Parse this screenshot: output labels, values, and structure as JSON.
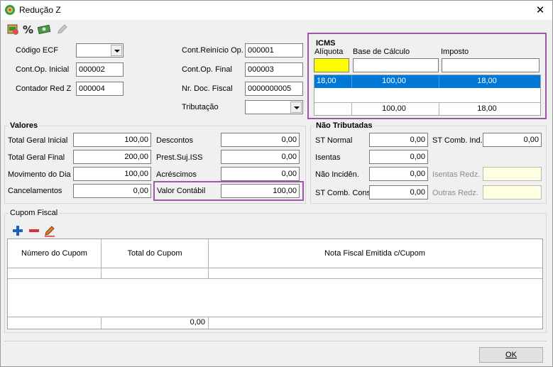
{
  "window": {
    "title": "Redução Z",
    "close": "✕"
  },
  "form": {
    "codigo_ecf": {
      "label": "Código ECF",
      "value": ""
    },
    "cont_op_inicial": {
      "label": "Cont.Op. Inicial",
      "value": "000002"
    },
    "contador_red_z": {
      "label": "Contador Red Z",
      "value": "000004"
    },
    "cont_reinicio_op": {
      "label": "Cont.Reinício Op.",
      "value": "000001"
    },
    "cont_op_final": {
      "label": "Cont.Op. Final",
      "value": "000003"
    },
    "nr_doc_fiscal": {
      "label": "Nr. Doc. Fiscal",
      "value": "0000000005"
    },
    "tributacao": {
      "label": "Tributação",
      "value": ""
    }
  },
  "icms": {
    "title": "ICMS",
    "headers": {
      "aliquota": "Alíquota",
      "base": "Base de Cálculo",
      "imposto": "Imposto"
    },
    "inputs": {
      "aliquota": "",
      "base": "",
      "imposto": ""
    },
    "rows": [
      {
        "aliquota": "18,00",
        "base": "100,00",
        "imposto": "18,00"
      }
    ],
    "totals": {
      "base": "100,00",
      "imposto": "18,00"
    }
  },
  "valores": {
    "title": "Valores",
    "total_geral_inicial": {
      "label": "Total Geral Inicial",
      "value": "100,00"
    },
    "total_geral_final": {
      "label": "Total Geral Final",
      "value": "200,00"
    },
    "movimento_dia": {
      "label": "Movimento do Dia",
      "value": "100,00"
    },
    "cancelamentos": {
      "label": "Cancelamentos",
      "value": "0,00"
    },
    "descontos": {
      "label": "Descontos",
      "value": "0,00"
    },
    "prest_suj_iss": {
      "label": "Prest.Suj.ISS",
      "value": "0,00"
    },
    "acrescimos": {
      "label": "Acréscimos",
      "value": "0,00"
    },
    "valor_contabil": {
      "label": "Valor Contábil",
      "value": "100,00"
    }
  },
  "nao_tributadas": {
    "title": "Não Tributadas",
    "st_normal": {
      "label": "ST Normal",
      "value": "0,00"
    },
    "isentas": {
      "label": "Isentas",
      "value": "0,00"
    },
    "nao_incidencia": {
      "label": "Não Incidên.",
      "value": "0,00"
    },
    "st_comb_cons": {
      "label": "ST Comb. Cons",
      "value": "0,00"
    },
    "st_comb_ind": {
      "label": "ST Comb. Ind.",
      "value": "0,00"
    },
    "isentas_redz": {
      "label": "Isentas Redz.",
      "value": ""
    },
    "outras_redz": {
      "label": "Outras Redz.",
      "value": ""
    }
  },
  "cupom_fiscal": {
    "title": "Cupom Fiscal",
    "columns": [
      "Número do Cupom",
      "Total do Cupom",
      "Nota Fiscal Emitida c/Cupom"
    ],
    "total": "0,00"
  },
  "footer": {
    "ok": "OK"
  },
  "colors": {
    "highlight": "#9b59a8",
    "selection": "#0078d7",
    "yellow": "#ffff00"
  }
}
